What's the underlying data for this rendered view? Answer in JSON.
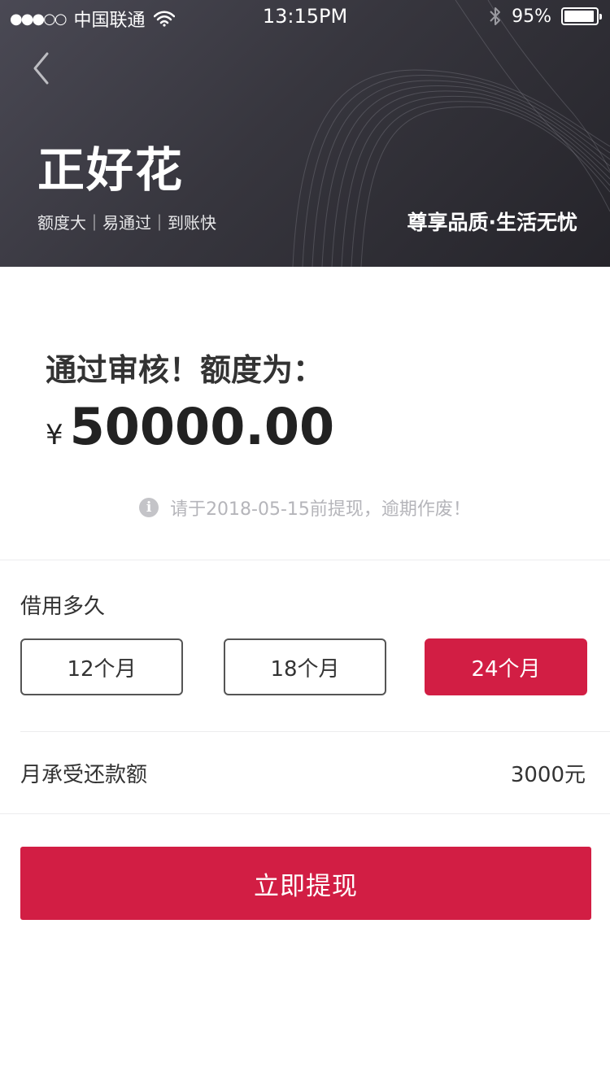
{
  "status_bar": {
    "signal": "●●●○○",
    "carrier": "中国联通",
    "time": "13:15PM",
    "battery_percent_label": "95%",
    "battery_level": 0.95
  },
  "header": {
    "brand_logo": "正好花",
    "slogan": "额度大｜易通过｜到账快",
    "tagline": "尊享品质·生活无忧"
  },
  "approval": {
    "title": "通过审核！额度为：",
    "currency_symbol": "¥",
    "amount": "50000.00",
    "notice": "请于2018-05-15前提现，逾期作废！"
  },
  "term": {
    "label": "借用多久",
    "options": [
      "12个月",
      "18个月",
      "24个月"
    ],
    "selected_index": 2
  },
  "repayment": {
    "label": "月承受还款额",
    "value": "3000元"
  },
  "cta": {
    "label": "立即提现"
  },
  "colors": {
    "accent": "#d21e44",
    "header_dark": "#2f2e35",
    "text_primary": "#333333",
    "text_muted": "#b5b5ba"
  },
  "icons": {
    "back": "chevron-left-icon",
    "wifi": "wifi-icon",
    "bluetooth": "bluetooth-icon",
    "battery": "battery-icon",
    "info": "info-icon"
  }
}
